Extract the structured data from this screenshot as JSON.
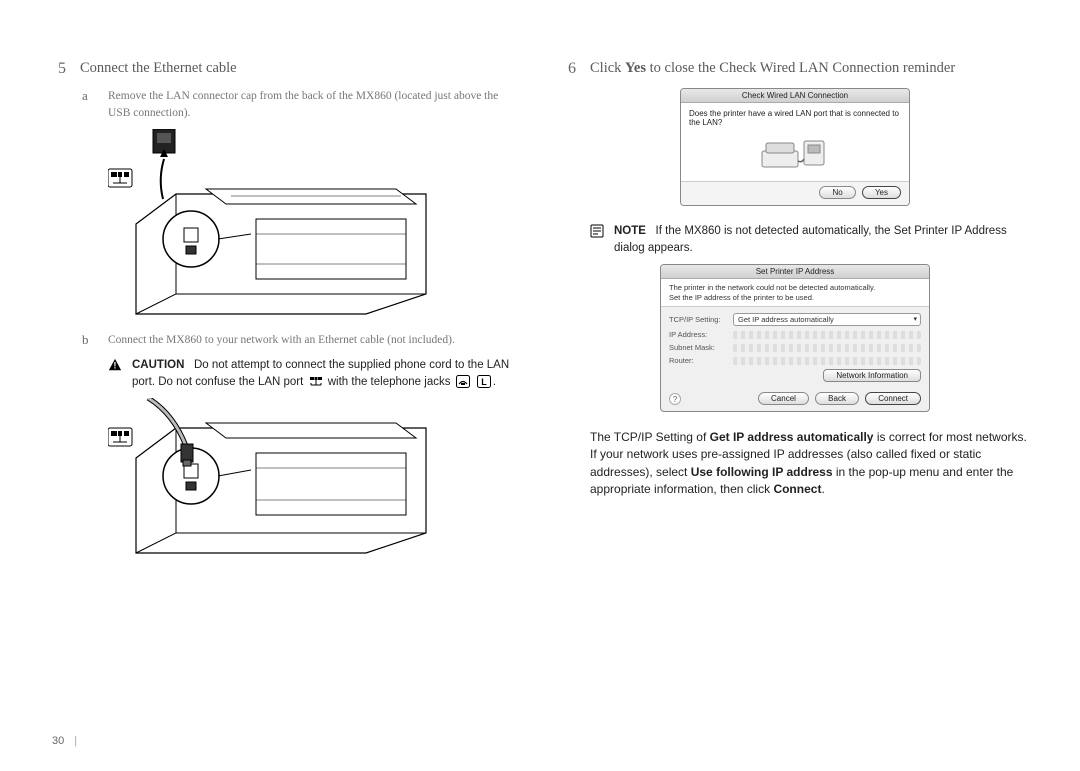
{
  "pageNumber": "30",
  "left": {
    "step5": {
      "num": "5",
      "title": "Connect the Ethernet cable",
      "a": {
        "letter": "a",
        "text": "Remove the LAN connector cap from the back of the MX860 (located just above the USB connection)."
      },
      "b": {
        "letter": "b",
        "text": "Connect the MX860 to your network with an Ethernet cable (not included)."
      },
      "caution": {
        "label": "CAUTION",
        "pre": "Do not attempt to connect the supplied phone cord to the LAN port. Do not confuse the LAN port ",
        "mid": " with the telephone jacks ",
        "post": "."
      }
    }
  },
  "right": {
    "step6": {
      "num": "6",
      "title_pre": "Click ",
      "title_bold": "Yes",
      "title_post": " to close the Check Wired LAN Connection reminder"
    },
    "dialog1": {
      "title": "Check Wired LAN Connection",
      "body": "Does the printer have a wired LAN port that is connected to the LAN?",
      "no": "No",
      "yes": "Yes"
    },
    "note": {
      "label": "NOTE",
      "text": "If the MX860 is not detected automatically, the Set Printer IP Address dialog appears."
    },
    "dialog2": {
      "title": "Set Printer IP Address",
      "msg": "The printer in the network could not be detected automatically.\nSet the IP address of the printer to be used.",
      "tcpLabel": "TCP/IP Setting:",
      "tcpValue": "Get IP address automatically",
      "ipLabel": "IP Address:",
      "subnetLabel": "Subnet Mask:",
      "routerLabel": "Router:",
      "netInfo": "Network Information",
      "cancel": "Cancel",
      "back": "Back",
      "connect": "Connect"
    },
    "body": {
      "t1": "The TCP/IP Setting of ",
      "b1": "Get IP address automatically",
      "t2": " is correct for most networks. If your network uses pre-assigned IP addresses (also called fixed or static addresses), select ",
      "b2": "Use following IP address",
      "t3": " in the pop-up menu and enter the appropriate information, then click ",
      "b3": "Connect",
      "t4": "."
    }
  }
}
